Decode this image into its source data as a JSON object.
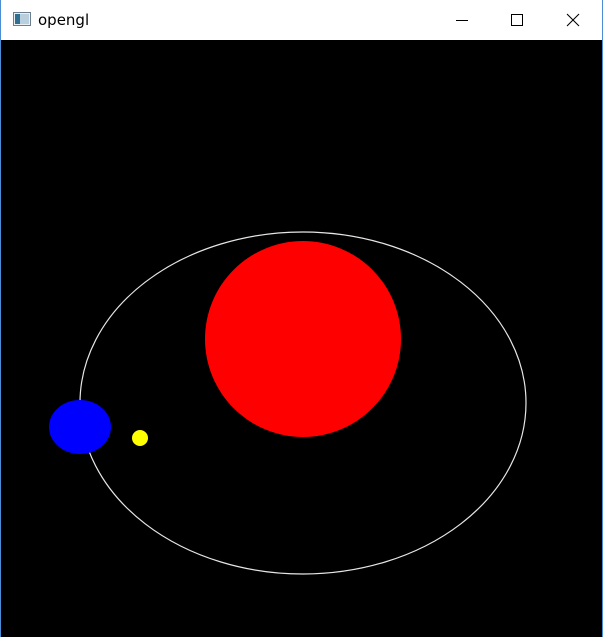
{
  "window": {
    "title": "opengl",
    "icon": "app-window-icon"
  },
  "title_bar_controls": [
    {
      "name": "minimize",
      "icon": "minimize-icon"
    },
    {
      "name": "maximize",
      "icon": "maximize-icon"
    },
    {
      "name": "close",
      "icon": "close-icon"
    }
  ],
  "scene": {
    "background": "#000000",
    "sun_color": "#ff0000",
    "planet_color": "#0000ff",
    "moon_color": "#ffff00",
    "orbit_color": "#e6e6e6"
  }
}
